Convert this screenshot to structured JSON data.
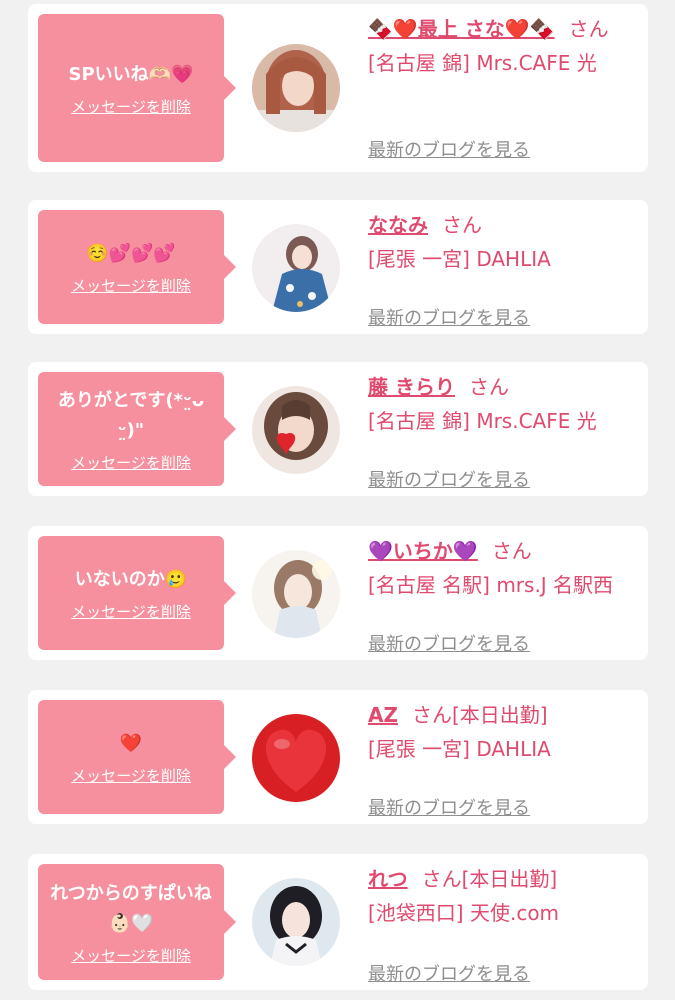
{
  "delete_label": "メッセージを削除",
  "san_label": "さん",
  "blog_label": "最新のブログを見る",
  "colors": {
    "accent": "#e04a6e",
    "bubble": "#f7909e",
    "link_gray": "#8e8e8e"
  },
  "messages": [
    {
      "text": "SPいいね🫶🏻💗",
      "name": "🍫❤️最上 さな❤️🍫",
      "status": "",
      "shop": "[名古屋 錦] Mrs.CAFE 光",
      "avatar_icon": "photo-woman-light-hair"
    },
    {
      "text": "☺️💕💕💕",
      "name": "ななみ",
      "status": "",
      "shop": "[尾張 一宮] DAHLIA",
      "avatar_icon": "photo-woman-yukata"
    },
    {
      "text": "ありがとです(*ᵕ̤ᴗᵕ̤)\"",
      "name": "藤 きらり",
      "status": "",
      "shop": "[名古屋 錦] Mrs.CAFE 光",
      "avatar_icon": "photo-woman-heart-sticker"
    },
    {
      "text": "いないのか🥲",
      "name": "💜いちか💜",
      "status": "",
      "shop": "[名古屋 名駅] mrs.J 名駅西",
      "avatar_icon": "photo-woman-bright"
    },
    {
      "text": "❤️",
      "name": "AZ",
      "status": "[本日出勤]",
      "shop": "[尾張 一宮] DAHLIA",
      "avatar_icon": "photo-red-heart"
    },
    {
      "text": "れつからのすぱいね👶🏻🤍",
      "name": "れつ",
      "status": "[本日出勤]",
      "shop": "[池袋西口] 天使.com",
      "avatar_icon": "photo-woman-dark-hair"
    }
  ]
}
